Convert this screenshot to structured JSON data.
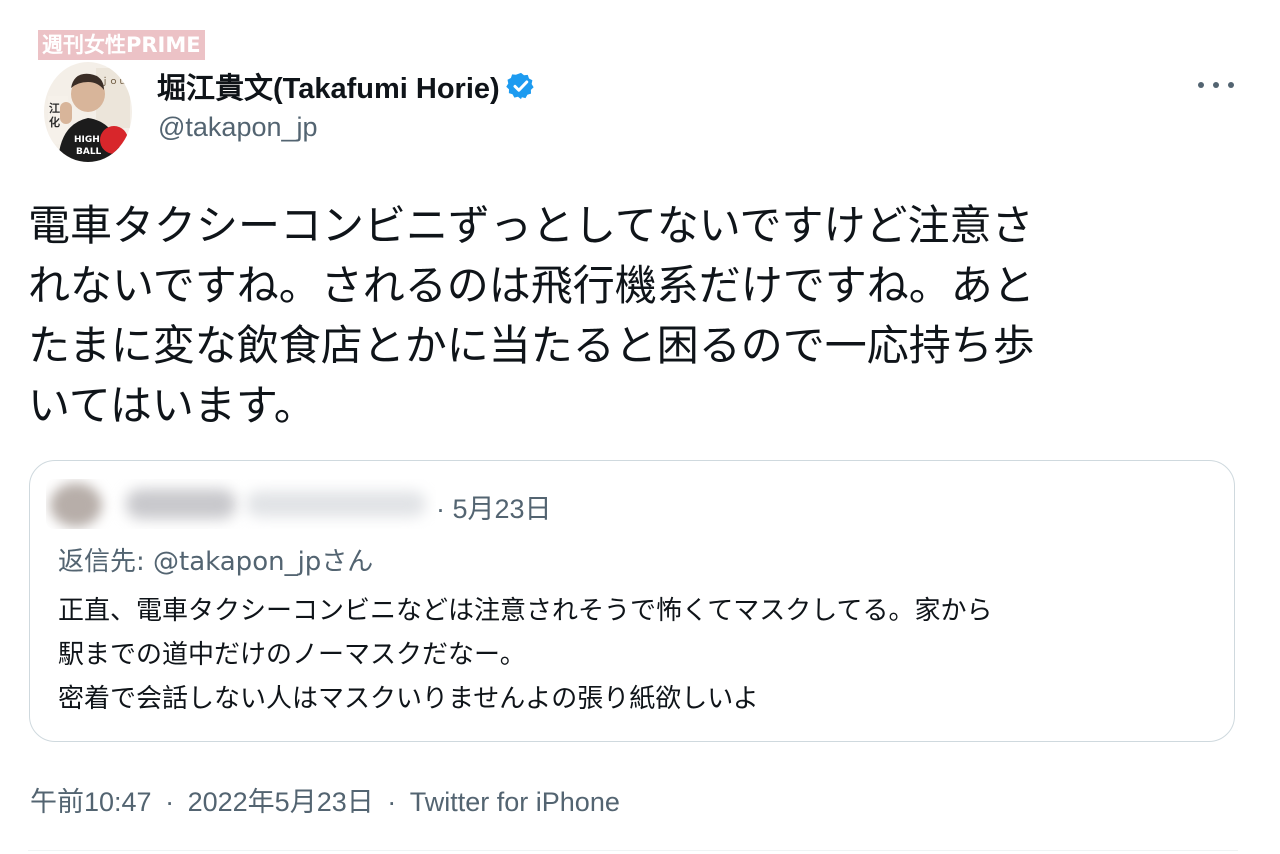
{
  "watermark": "週刊女性PRIME",
  "author": {
    "display_name": "堀江貴文(Takafumi Horie)",
    "handle": "@takapon_jp",
    "verified": true,
    "avatar_icon": "profile-photo"
  },
  "menu_icon": "more-horizontal-icon",
  "tweet": {
    "text_lines": [
      "電車タクシーコンビニずっとしてないですけど注意さ",
      "れないですね。されるのは飛行機系だけですね。あと",
      "たまに変な飲食店とかに当たると困るので一応持ち歩",
      "いてはいます。"
    ]
  },
  "quote": {
    "date": "· 5月23日",
    "reply_to": "返信先: @takapon_jpさん",
    "text_lines": [
      "正直、電車タクシーコンビニなどは注意されそうで怖くてマスクしてる。家から",
      "駅までの道中だけのノーマスクだなー。",
      "密着で会話しない人はマスクいりませんよの張り紙欲しいよ"
    ]
  },
  "meta": {
    "time": "午前10:47",
    "date": "2022年5月23日",
    "source": "Twitter for iPhone",
    "separator": "·"
  },
  "colors": {
    "verified_blue": "#1d9bf0",
    "secondary_text": "#536471",
    "primary_text": "#0f1419",
    "border": "#cfd9de",
    "watermark_bg": "#ecc2c6"
  }
}
